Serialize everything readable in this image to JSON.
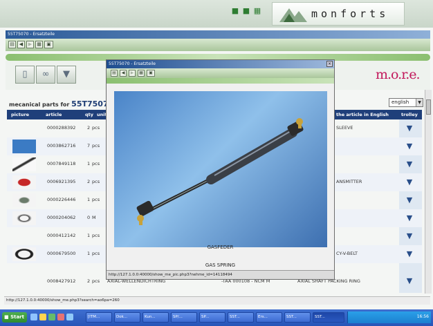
{
  "header": {
    "brand": "monforts",
    "icons": [
      "user-icon",
      "group-icon",
      "network-icon"
    ]
  },
  "window": {
    "title": "55T75070 - Ersatzteile",
    "toolbar": [
      "page-icon",
      "back-icon",
      "forward-icon",
      "print-icon",
      "monitor-icon"
    ]
  },
  "modes": [
    "rail-icon",
    "glasses-icon",
    "cart-icon"
  ],
  "more_logo": "m.o.r.e.",
  "parts": {
    "title_prefix": "mecanical parts for",
    "title_id": "55T75070",
    "language": "english",
    "columns": {
      "picture": "picture",
      "article": "article",
      "qty": "qty",
      "unit": "unit",
      "english": "the article in English",
      "trolley": "trolley"
    },
    "rows": [
      {
        "article": "0000288392",
        "qty": "2",
        "unit": "pcs",
        "english": "SLEEVE",
        "thumb": ""
      },
      {
        "article": "0003862716",
        "qty": "7",
        "unit": "pcs",
        "english": "",
        "thumb": "blue"
      },
      {
        "article": "0007849118",
        "qty": "1",
        "unit": "pcs",
        "english": "",
        "thumb": "rod"
      },
      {
        "article": "0006921395",
        "qty": "2",
        "unit": "pcs",
        "english": "ANSMITTER",
        "thumb": "red"
      },
      {
        "article": "0000226446",
        "qty": "1",
        "unit": "pcs",
        "english": "",
        "thumb": "part"
      },
      {
        "article": "0000204062",
        "qty": "0",
        "unit": "M",
        "english": "",
        "thumb": "coil"
      },
      {
        "article": "0000412142",
        "qty": "1",
        "unit": "pcs",
        "english": "",
        "thumb": ""
      },
      {
        "article": "0000679500",
        "qty": "1",
        "unit": "pcs",
        "english": "CY-V-BELT",
        "thumb": "ring"
      },
      {
        "article": "0008427912",
        "qty": "2",
        "unit": "pcs",
        "german": "AXIAL-WELLENDICHTRING",
        "code": "-TAA 000108 - NCM M",
        "english": "AXIAL SHAFT PACKING RING",
        "thumb": ""
      }
    ]
  },
  "popup": {
    "title": "55T75070 - Ersatzteile",
    "caption_de": "GASFEDER",
    "caption_en": "GAS SPRING",
    "status": "http://127.1.0.0:40000/show_me_pic.php3?nehme_id=14118494"
  },
  "statusbar": "http://127.1.0.0:40000/show_me.php3?search=ao6pa=260",
  "taskbar": {
    "start": "Start",
    "tasks": [
      "[ITM...",
      "Dok...",
      "Kun...",
      "SP/...",
      "SP...",
      "SST...",
      "Ers...",
      "SST...",
      "SST..."
    ],
    "clock": "16:56"
  },
  "colors": {
    "table_header": "#1f3f7a",
    "accent_green": "#8bbf70",
    "taskbar": "#2754b8",
    "more_logo": "#c2185b"
  }
}
